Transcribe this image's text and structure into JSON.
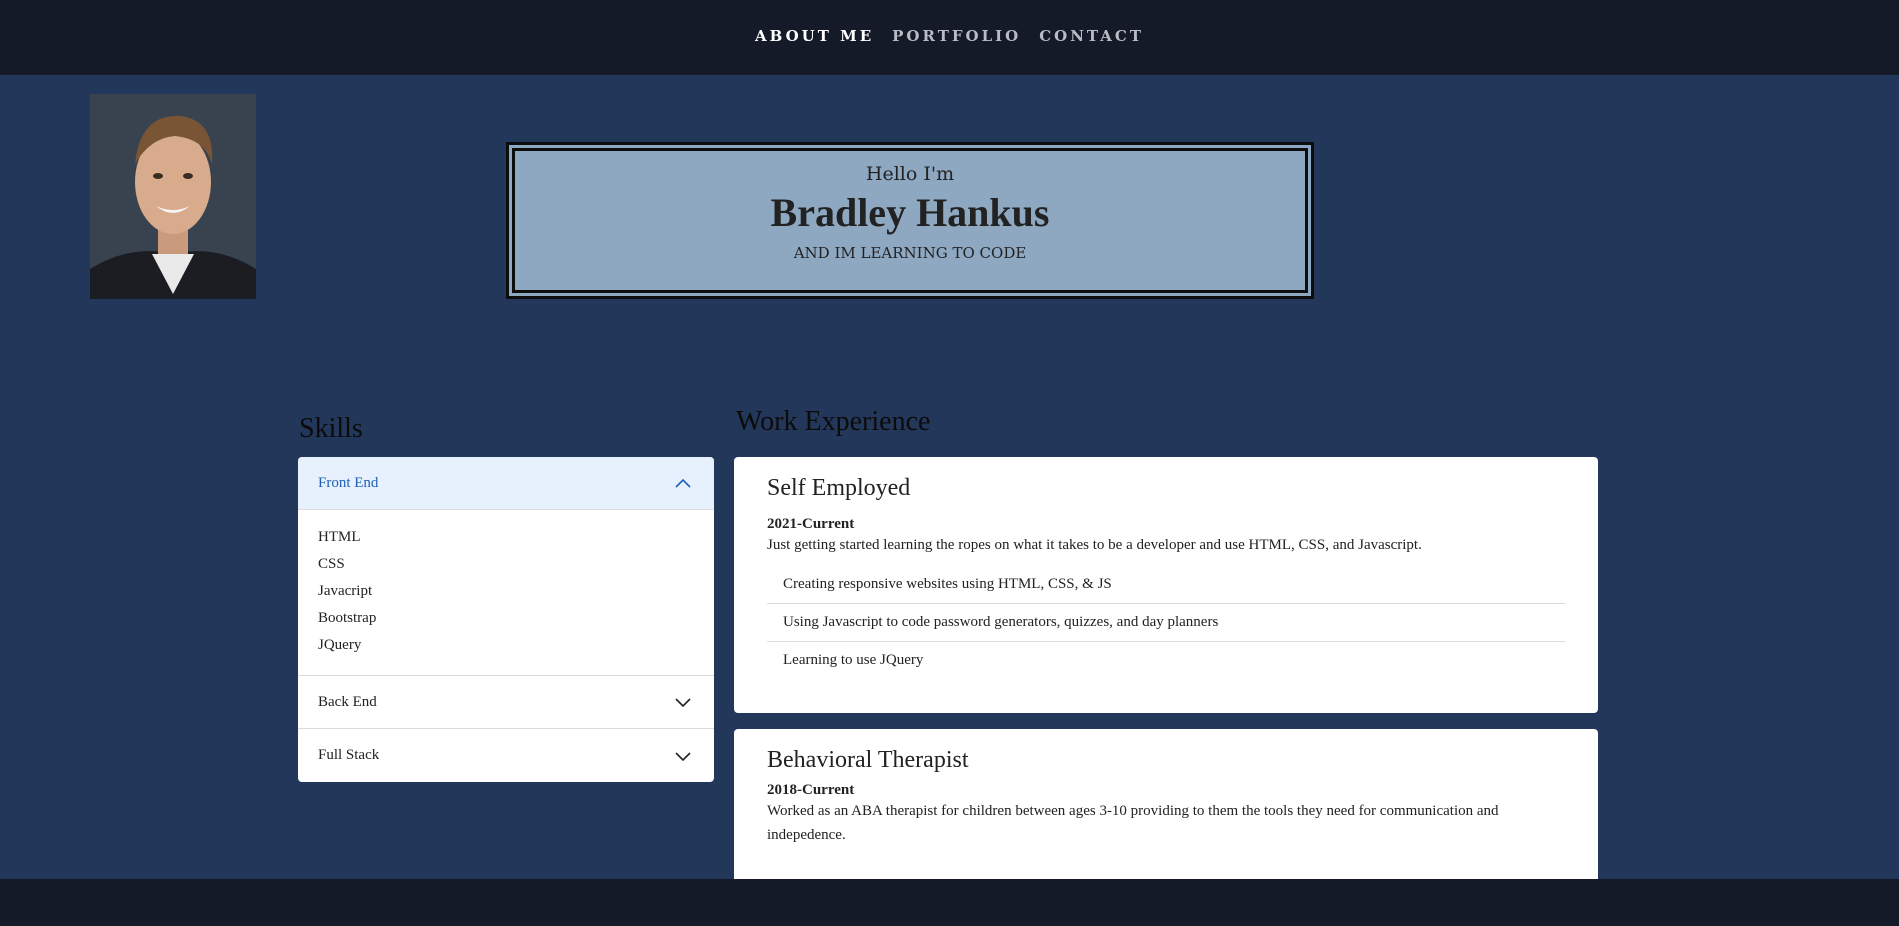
{
  "nav": {
    "items": [
      {
        "label": "ABOUT ME",
        "active": true
      },
      {
        "label": "PORTFOLIO",
        "active": false
      },
      {
        "label": "CONTACT",
        "active": false
      }
    ]
  },
  "hero": {
    "greeting": "Hello I'm",
    "name": "Bradley Hankus",
    "tagline": "AND IM LEARNING TO CODE"
  },
  "skills": {
    "title": "Skills",
    "sections": [
      {
        "label": "Front End",
        "expanded": true,
        "items": [
          "HTML",
          "CSS",
          "Javacript",
          "Bootstrap",
          "JQuery"
        ]
      },
      {
        "label": "Back End",
        "expanded": false
      },
      {
        "label": "Full Stack",
        "expanded": false
      }
    ]
  },
  "work": {
    "title": "Work Experience",
    "jobs": [
      {
        "title": "Self Employed",
        "years": "2021-Current",
        "description": "Just getting started learning the ropes on what it takes to be a developer and use HTML, CSS, and Javascript.",
        "bullets": [
          "Creating responsive websites using HTML, CSS, & JS",
          "Using Javascript to code password generators, quizzes, and day planners",
          "Learning to use JQuery"
        ]
      },
      {
        "title": "Behavioral Therapist",
        "years": "2018-Current",
        "description": "Worked as an ABA therapist for children between ages 3-10 providing to them the tools they need for communication and indepedence."
      }
    ]
  },
  "colors": {
    "page_bg": "#23375a",
    "bar_bg": "#151a28",
    "hero_bg": "#8fa8c2",
    "accent": "#1c5fb8"
  }
}
